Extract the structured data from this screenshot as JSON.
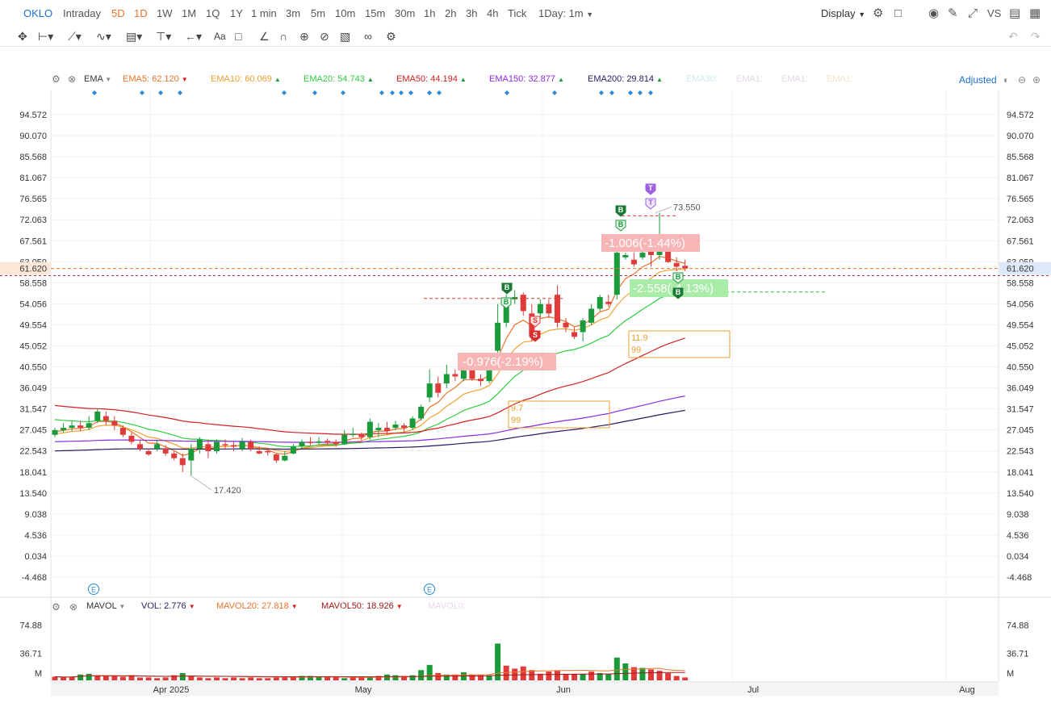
{
  "toolbar": {
    "symbol": "OKLO",
    "intervals": [
      "Intraday",
      "5D",
      "1D",
      "1W",
      "1M",
      "1Q",
      "1Y",
      "1 min",
      "3m",
      "5m",
      "10m",
      "15m",
      "30m",
      "1h",
      "2h",
      "3h",
      "4h",
      "Tick"
    ],
    "range": "1Day: 1m",
    "display": "Display",
    "vs": "VS"
  },
  "indicators": {
    "main": "EMA",
    "ema5": "EMA5:",
    "ema5_val": "62.120",
    "ema10": "EMA10:",
    "ema10_val": "60.069",
    "ema20": "EMA20:",
    "ema20_val": "54.743",
    "ema50": "EMA50:",
    "ema50_val": "44.194",
    "ema150": "EMA150:",
    "ema150_val": "32.877",
    "ema200": "EMA200:",
    "ema200_val": "29.814",
    "faded": [
      "EMA30:",
      "EMA1:",
      "EMA1:",
      "EMA1:"
    ],
    "adjusted": "Adjusted"
  },
  "volume_indicators": {
    "name": "MAVOL",
    "vol": "VOL:",
    "vol_val": "2.776",
    "mavol20": "MAVOL20:",
    "mavol20_val": "27.818",
    "mavol50": "MAVOL50:",
    "mavol50_val": "18.926",
    "faded": "MAVOL0:"
  },
  "colors": {
    "up": "#1a9a3a",
    "down": "#e03b3b",
    "ema5": "#e8742a",
    "ema10": "#f0a030",
    "ema20": "#2ecc40",
    "ema50": "#d42020",
    "ema150": "#8a2be2",
    "ema200": "#2a1860"
  },
  "chart_data": {
    "type": "candlestick",
    "y_ticks": [
      "94.572",
      "90.070",
      "85.568",
      "81.067",
      "76.565",
      "72.063",
      "67.561",
      "63.059",
      "58.558",
      "54.056",
      "49.554",
      "45.052",
      "40.550",
      "36.049",
      "31.547",
      "27.045",
      "22.543",
      "18.041",
      "13.540",
      "9.038",
      "4.536",
      "0.034",
      "-4.468"
    ],
    "ylim": [
      -4.468,
      94.572
    ],
    "x_labels": [
      "Apr 2025",
      "May",
      "Jun",
      "Jul",
      "Aug"
    ],
    "last_price": "61.620",
    "high_label": "73.550",
    "low_label": "17.420",
    "markers": {
      "buy": "B",
      "sell": "S",
      "take": "T",
      "event": "E"
    },
    "boxes": [
      {
        "line1": "9.7",
        "line2": "99"
      },
      {
        "line1": "11.9",
        "line2": "99"
      }
    ],
    "trades": [
      "-0.976(-2.19%)",
      "-1.006(-1.44%)",
      "-2.558(-4.13%)"
    ],
    "candles": [
      [
        26,
        27,
        25.5,
        27.5
      ],
      [
        27,
        27.5,
        26.5,
        28.5
      ],
      [
        27.5,
        28,
        26.8,
        29
      ],
      [
        28,
        27.5,
        26.8,
        29
      ],
      [
        27.5,
        28.5,
        27,
        30
      ],
      [
        29,
        31,
        28.5,
        31.5
      ],
      [
        30,
        29,
        28,
        31
      ],
      [
        29,
        28,
        27,
        30
      ],
      [
        27.5,
        26,
        25.5,
        28
      ],
      [
        25.8,
        24.5,
        24,
        26.5
      ],
      [
        24,
        23,
        22.5,
        25
      ],
      [
        22.5,
        21.8,
        21.5,
        23
      ],
      [
        23,
        24,
        22.5,
        25
      ],
      [
        23,
        22,
        21.5,
        23.8
      ],
      [
        22,
        21,
        20.5,
        22.5
      ],
      [
        21,
        19.5,
        18,
        22
      ],
      [
        20.5,
        23,
        17.4,
        24
      ],
      [
        23,
        25,
        22,
        25.5
      ],
      [
        24,
        22.5,
        21,
        25
      ],
      [
        22.5,
        24.5,
        22,
        25
      ],
      [
        24,
        23.8,
        23,
        25
      ],
      [
        23.8,
        23.5,
        22.5,
        24.5
      ],
      [
        23,
        24.5,
        22.5,
        25.3
      ],
      [
        24.5,
        23,
        22.5,
        25
      ],
      [
        22.5,
        22,
        21.8,
        23.5
      ],
      [
        22.5,
        22.3,
        21.5,
        23
      ],
      [
        21.8,
        20.5,
        20,
        22
      ],
      [
        20.5,
        21.5,
        20.3,
        22.5
      ],
      [
        22,
        23.5,
        21.8,
        24
      ],
      [
        23.5,
        24.5,
        23,
        25
      ],
      [
        24.5,
        24.3,
        23.8,
        25.5
      ],
      [
        24.3,
        24.6,
        24,
        25.5
      ],
      [
        24.7,
        24.4,
        23.8,
        25.2
      ],
      [
        24.5,
        24,
        23.5,
        25
      ],
      [
        24,
        26,
        23.8,
        27
      ],
      [
        26,
        26.2,
        25.5,
        27.5
      ],
      [
        26,
        25.5,
        24.8,
        26.5
      ],
      [
        25.5,
        28.8,
        25,
        29.5
      ],
      [
        27,
        27.5,
        25.5,
        28.5
      ],
      [
        27.5,
        26.8,
        26,
        28.8
      ],
      [
        27.5,
        28.2,
        27,
        29
      ],
      [
        28,
        27.5,
        26.5,
        28.5
      ],
      [
        27.5,
        29.5,
        27,
        30
      ],
      [
        29.5,
        32,
        29,
        32.5
      ],
      [
        34,
        37,
        33,
        40
      ],
      [
        37,
        35,
        34,
        38.5
      ],
      [
        37,
        39,
        36,
        41
      ],
      [
        39,
        38.5,
        37.5,
        40
      ],
      [
        38,
        41,
        37.5,
        42
      ],
      [
        40,
        38,
        37.5,
        41
      ],
      [
        38,
        37.5,
        36.5,
        39
      ],
      [
        37.5,
        40.5,
        37,
        42
      ],
      [
        44,
        50,
        43,
        54
      ],
      [
        50,
        55,
        49,
        56
      ],
      [
        55,
        55.5,
        54,
        57
      ],
      [
        56,
        52.5,
        51.5,
        56.5
      ],
      [
        52,
        47,
        46,
        54
      ],
      [
        52,
        54,
        51,
        55
      ],
      [
        54,
        52,
        51,
        55
      ],
      [
        56,
        50,
        49,
        58
      ],
      [
        50,
        49,
        48,
        51
      ],
      [
        48,
        47,
        46.5,
        49
      ],
      [
        48,
        50.5,
        46,
        51
      ],
      [
        50,
        53,
        49.5,
        54
      ],
      [
        53,
        55.5,
        52.5,
        56
      ],
      [
        54.5,
        54,
        53.5,
        56
      ],
      [
        56,
        65,
        55,
        68
      ],
      [
        64,
        64.5,
        63.5,
        65
      ],
      [
        63.5,
        62.5,
        62,
        65
      ],
      [
        64,
        65,
        63.5,
        66
      ],
      [
        65.5,
        64.5,
        62,
        66
      ],
      [
        64.5,
        67,
        63.5,
        73.55
      ],
      [
        68,
        63,
        62.8,
        68.5
      ],
      [
        62.8,
        62,
        61,
        64
      ],
      [
        62.2,
        61.6,
        61,
        63.5
      ]
    ],
    "volumes": [
      [
        5,
        "d"
      ],
      [
        4,
        "d"
      ],
      [
        5,
        "d"
      ],
      [
        8,
        "u"
      ],
      [
        9,
        "u"
      ],
      [
        7,
        "d"
      ],
      [
        6,
        "d"
      ],
      [
        6,
        "d"
      ],
      [
        5,
        "d"
      ],
      [
        7,
        "d"
      ],
      [
        4,
        "d"
      ],
      [
        4,
        "d"
      ],
      [
        3,
        "d"
      ],
      [
        4,
        "d"
      ],
      [
        7,
        "d"
      ],
      [
        10,
        "u"
      ],
      [
        6,
        "d"
      ],
      [
        4,
        "d"
      ],
      [
        3,
        "d"
      ],
      [
        4,
        "d"
      ],
      [
        3,
        "d"
      ],
      [
        4,
        "d"
      ],
      [
        3,
        "d"
      ],
      [
        4,
        "d"
      ],
      [
        3,
        "d"
      ],
      [
        3,
        "d"
      ],
      [
        4,
        "d"
      ],
      [
        4,
        "d"
      ],
      [
        5,
        "d"
      ],
      [
        6,
        "u"
      ],
      [
        6,
        "u"
      ],
      [
        5,
        "u"
      ],
      [
        5,
        "d"
      ],
      [
        5,
        "d"
      ],
      [
        3,
        "u"
      ],
      [
        5,
        "d"
      ],
      [
        4,
        "d"
      ],
      [
        5,
        "u"
      ],
      [
        6,
        "d"
      ],
      [
        8,
        "u"
      ],
      [
        7,
        "u"
      ],
      [
        6,
        "d"
      ],
      [
        7,
        "u"
      ],
      [
        14,
        "u"
      ],
      [
        21,
        "u"
      ],
      [
        10,
        "d"
      ],
      [
        8,
        "u"
      ],
      [
        8,
        "d"
      ],
      [
        11,
        "u"
      ],
      [
        8,
        "d"
      ],
      [
        7,
        "d"
      ],
      [
        7,
        "u"
      ],
      [
        50,
        "u"
      ],
      [
        20,
        "d"
      ],
      [
        16,
        "d"
      ],
      [
        19,
        "d"
      ],
      [
        14,
        "d"
      ],
      [
        9,
        "d"
      ],
      [
        12,
        "d"
      ],
      [
        13,
        "d"
      ],
      [
        9,
        "d"
      ],
      [
        9,
        "d"
      ],
      [
        9,
        "u"
      ],
      [
        12,
        "d"
      ],
      [
        10,
        "u"
      ],
      [
        9,
        "u"
      ],
      [
        31,
        "u"
      ],
      [
        23,
        "u"
      ],
      [
        18,
        "d"
      ],
      [
        17,
        "u"
      ],
      [
        15,
        "d"
      ],
      [
        13,
        "d"
      ],
      [
        10,
        "d"
      ],
      [
        6,
        "d"
      ],
      [
        4,
        "d"
      ]
    ],
    "vol_ticks": [
      "74.88",
      "36.71",
      "M"
    ]
  }
}
